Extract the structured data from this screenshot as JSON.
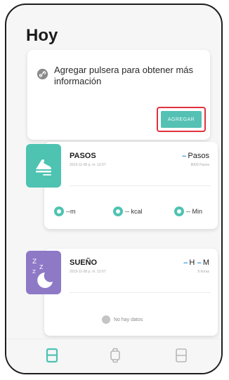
{
  "header": {
    "title": "Hoy"
  },
  "notice": {
    "text": "Agregar pulsera para obtener más información",
    "button_label": "AGREGAR"
  },
  "steps_card": {
    "title": "PASOS",
    "time": "2019-11-08 p. m. 12:07",
    "value_prefix": "--",
    "value_label": "Pasos",
    "goal": "8000 Pasos",
    "metrics": [
      {
        "value": "--m",
        "icon": "location-pin-icon"
      },
      {
        "value": "-- kcal",
        "icon": "flame-icon"
      },
      {
        "value": "-- Min",
        "icon": "clock-icon"
      }
    ]
  },
  "sleep_card": {
    "title": "SUEÑO",
    "time": "2019-11-08 p. m. 12:07",
    "hours_prefix": "--",
    "hours_unit": "H",
    "minutes_prefix": "--",
    "minutes_unit": "M",
    "goal": "8 horas",
    "empty_text": "No hay datos"
  },
  "tabs": [
    {
      "icon": "today-tab-icon",
      "active": true
    },
    {
      "icon": "watch-tab-icon",
      "active": false
    },
    {
      "icon": "profile-tab-icon",
      "active": false
    }
  ],
  "colors": {
    "teal": "#4ec3b2",
    "purple": "#8e79c6",
    "highlight_red": "#e0323e",
    "dash_blue": "#4aa6d8"
  }
}
